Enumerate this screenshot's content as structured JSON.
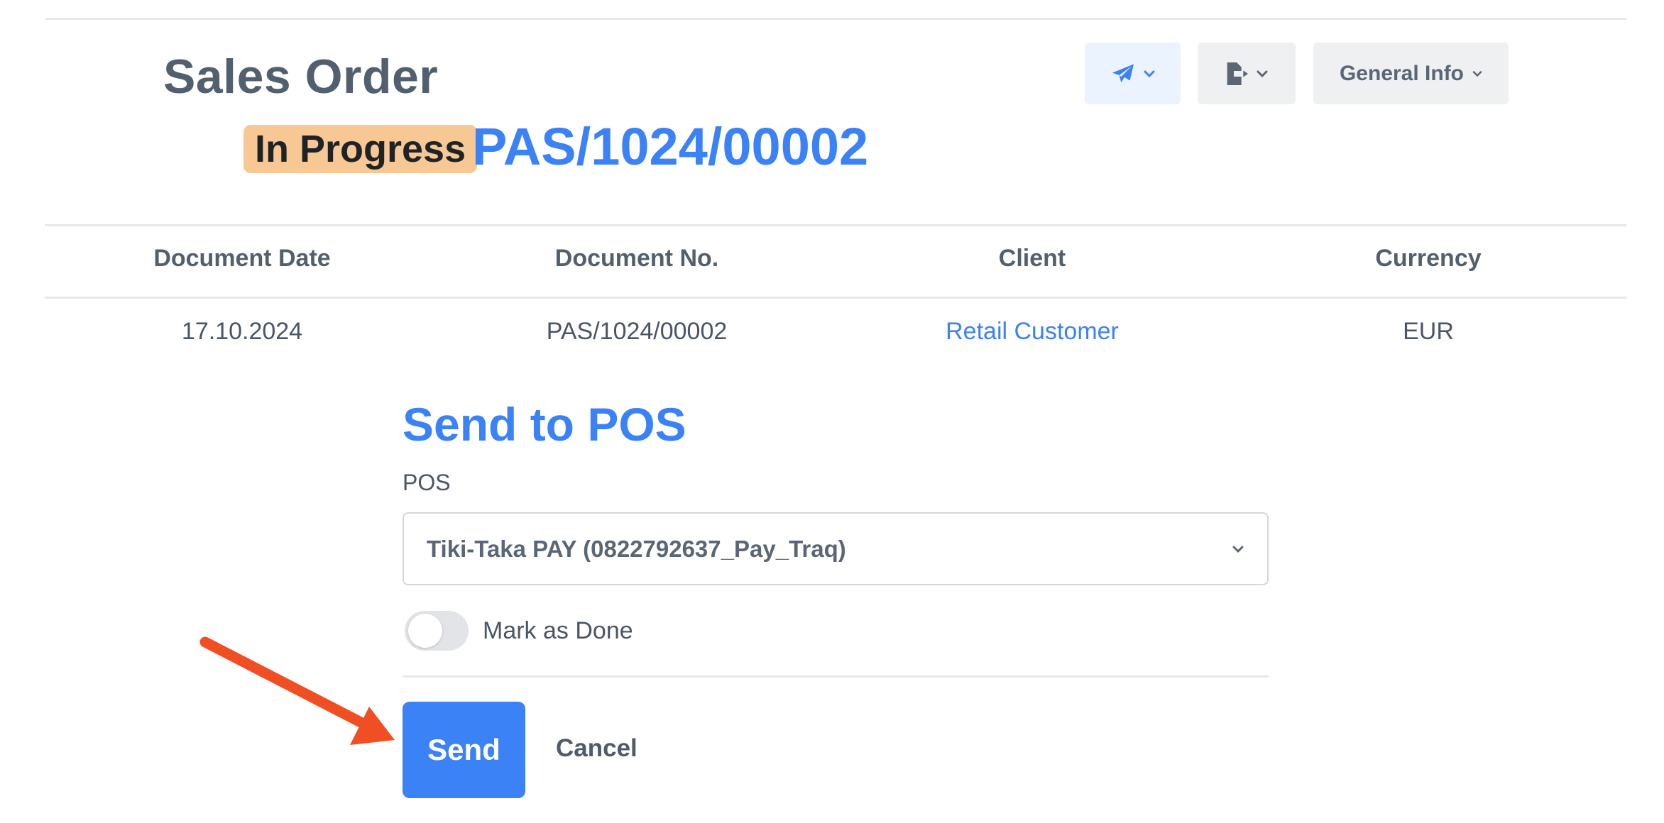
{
  "header": {
    "title": "Sales Order",
    "status_badge": "In Progress",
    "document_number": "PAS/1024/00002",
    "toolbar": {
      "send_icon": "paper-plane-icon",
      "export_icon": "file-export-icon",
      "info_label": "General Info"
    }
  },
  "summary_table": {
    "headers": [
      "Document Date",
      "Document No.",
      "Client",
      "Currency"
    ],
    "row": [
      "17.10.2024",
      "PAS/1024/00002",
      "Retail Customer",
      "EUR"
    ]
  },
  "dialog": {
    "title": "Send to POS",
    "pos_label": "POS",
    "pos_value": "Tiki-Taka PAY (0822792637_Pay_Traq)",
    "mark_done_label": "Mark as Done",
    "mark_done_checked": false,
    "send_label": "Send",
    "cancel_label": "Cancel"
  },
  "colors": {
    "accent": "#3b82f6",
    "badge": "#f7c894",
    "annotation_arrow": "#f04e23"
  }
}
